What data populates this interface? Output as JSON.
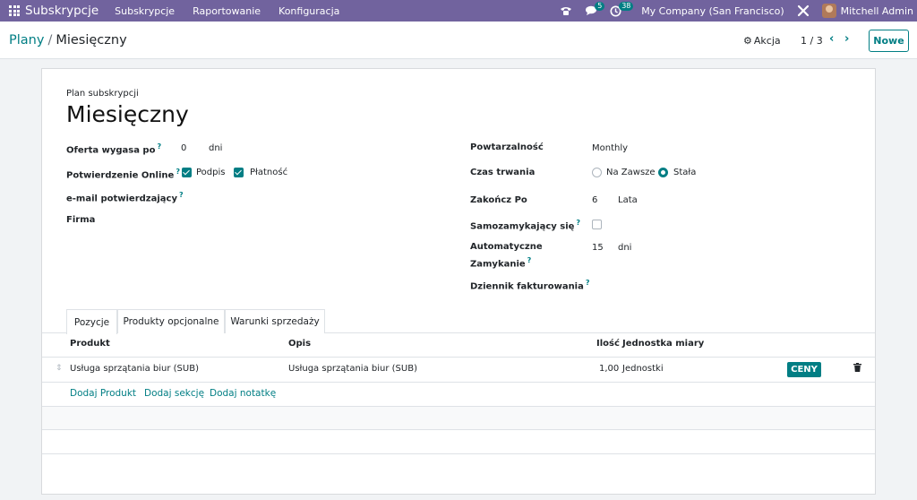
{
  "navbar": {
    "app_name": "Subskrypcje",
    "menus": [
      "Subskrypcje",
      "Raportowanie",
      "Konfiguracja"
    ],
    "messages_count": "5",
    "activities_count": "38",
    "company": "My Company (San Francisco)",
    "user": "Mitchell Admin",
    "brand_color": "#71639e"
  },
  "control": {
    "breadcrumb_parent": "Plany",
    "breadcrumb_separator": "/",
    "breadcrumb_current": "Miesięczny",
    "action_label": "Akcja",
    "pager": "1 / 3",
    "new_button": "Nowe"
  },
  "form": {
    "subtitle": "Plan subskrypcji",
    "title": "Miesięczny",
    "left": {
      "offer_expires_label": "Oferta wygasa po",
      "offer_expires_value": "0",
      "offer_expires_unit": "dni",
      "online_confirm_label": "Potwierdzenie Online",
      "signature_label": "Podpis",
      "signature_checked": true,
      "payment_label": "Płatność",
      "payment_checked": true,
      "confirm_email_label": "e-mail potwierdzający",
      "company_label": "Firma"
    },
    "right": {
      "recurrence_label": "Powtarzalność",
      "recurrence_value": "Monthly",
      "duration_label": "Czas trwania",
      "duration_forever": "Na Zawsze",
      "duration_fixed": "Stała",
      "end_after_label": "Zakończ Po",
      "end_after_value": "6",
      "end_after_unit": "Lata",
      "self_closing_label": "Samozamykający się",
      "auto_close_label_1": "Automatyczne",
      "auto_close_label_2": "Zamykanie",
      "auto_close_value": "15",
      "auto_close_unit": "dni",
      "journal_label": "Dziennik fakturowania"
    }
  },
  "tabs": [
    "Pozycje",
    "Produkty opcjonalne",
    "Warunki sprzedaży"
  ],
  "table": {
    "headers": {
      "product": "Produkt",
      "description": "Opis",
      "quantity": "Ilość",
      "uom": "Jednostka miary"
    },
    "rows": [
      {
        "product": "Usługa sprzątania biur (SUB)",
        "description": "Usługa sprzątania biur (SUB)",
        "quantity": "1,00",
        "uom": "Jednostki",
        "button": "CENY"
      }
    ],
    "add_product": "Dodaj Produkt",
    "add_section": "Dodaj sekcję",
    "add_note": "Dodaj notatkę"
  },
  "accent_color": "#017e84"
}
